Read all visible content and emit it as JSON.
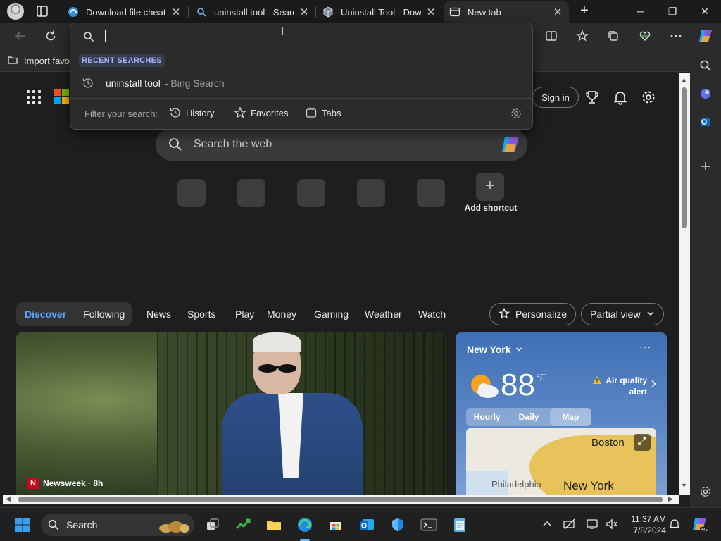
{
  "tabs": [
    {
      "label": "Download file cheat.r",
      "icon": "edge-download-icon",
      "close": "✕"
    },
    {
      "label": "uninstall tool - Search",
      "icon": "search-icon",
      "close": "✕"
    },
    {
      "label": "Uninstall Tool - Down",
      "icon": "cube-icon",
      "close": "✕"
    },
    {
      "label": "New tab",
      "icon": "newtab-icon",
      "close": "✕",
      "active": true
    }
  ],
  "window": {
    "minimize": "─",
    "maximize": "❐",
    "close": "✕",
    "new_tab": "+"
  },
  "favorites_bar": {
    "import_label": "Import favo"
  },
  "omnibox": {
    "section_label": "RECENT SEARCHES",
    "suggestion": {
      "query": "uninstall tool",
      "source": "- Bing Search"
    },
    "filter_label": "Filter your search:",
    "filters": [
      {
        "label": "History",
        "icon": "history-icon"
      },
      {
        "label": "Favorites",
        "icon": "star-icon"
      },
      {
        "label": "Tabs",
        "icon": "tabs-icon"
      }
    ]
  },
  "newtab": {
    "sign_in": "Sign in",
    "search_placeholder": "Search the web",
    "add_shortcut": "Add shortcut",
    "add_symbol": "+"
  },
  "feed": {
    "segments": [
      {
        "label": "Discover",
        "active": true
      },
      {
        "label": "Following",
        "active": false
      }
    ],
    "nav": [
      "News",
      "Sports",
      "Play",
      "Money",
      "Gaming",
      "Weather",
      "Watch"
    ],
    "personalize": "Personalize",
    "partial_view": "Partial view"
  },
  "hero": {
    "source": "Newsweek · 8h",
    "source_logo": "N"
  },
  "weather": {
    "location": "New York",
    "more": "···",
    "temperature": "88",
    "unit": "°F",
    "air_quality_line1": "Air quality",
    "air_quality_line2": "alert",
    "tabs": [
      {
        "label": "Hourly"
      },
      {
        "label": "Daily"
      },
      {
        "label": "Map",
        "active": true
      }
    ],
    "map_cities": [
      "Boston",
      "Philadelphia",
      "New York"
    ]
  },
  "taskbar": {
    "search_label": "Search",
    "time": "11:37 AM",
    "date": "7/8/2024"
  }
}
